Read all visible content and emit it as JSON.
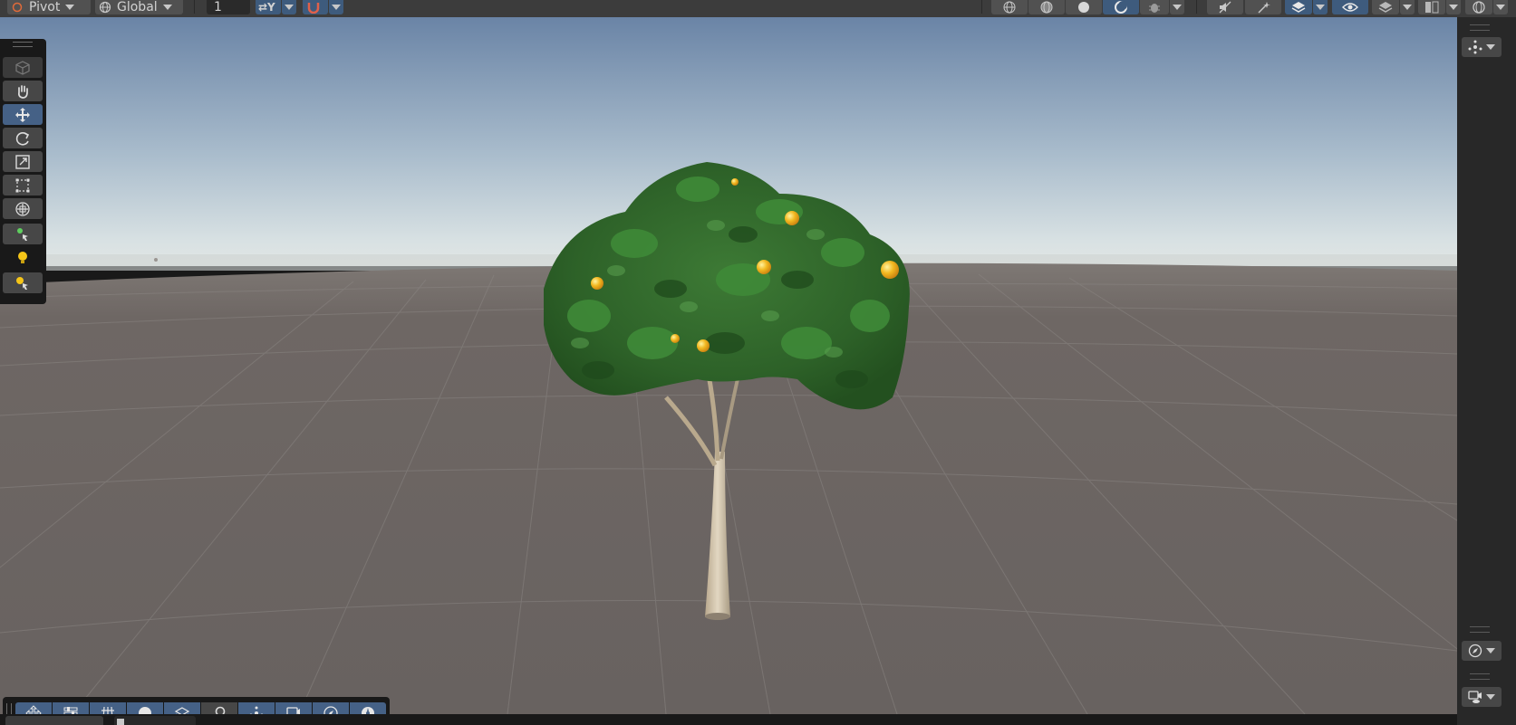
{
  "toolbar": {
    "pivot_label": "Pivot",
    "global_label": "Global",
    "snap_value": "1",
    "axis_label": "⇄Y"
  },
  "icons": {
    "hand": "hand-tool-icon",
    "move": "move-tool-icon",
    "rotate": "rotate-tool-icon",
    "scale": "scale-tool-icon",
    "rect": "rect-tool-icon",
    "transform": "transform-tool-icon",
    "lightbulb": "lightbulb-icon",
    "gizmo": "gizmo-icon"
  },
  "colors": {
    "active_tool": "#456186",
    "toolbar_bg": "#3c3c3c",
    "panel_bg": "#282828",
    "sky_top": "#6d86a6",
    "horizon": "#dbe3e4",
    "ground": "#6d6663"
  }
}
